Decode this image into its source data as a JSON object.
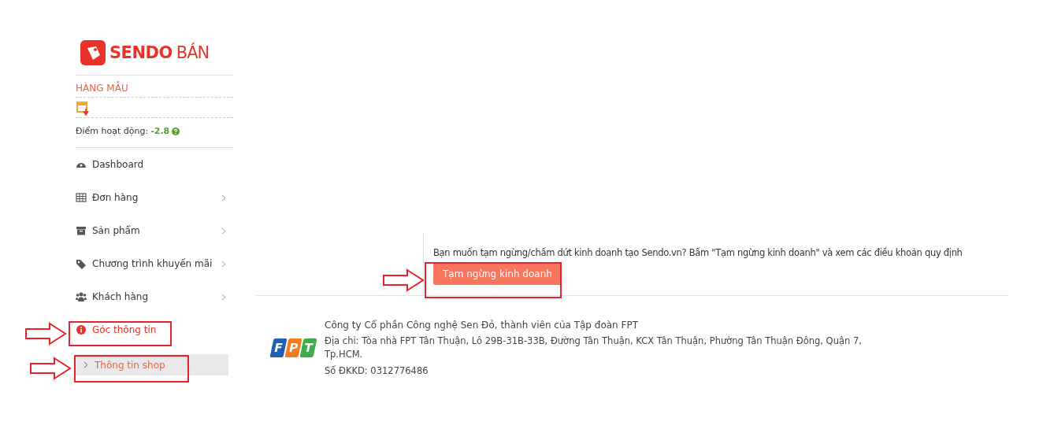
{
  "logo": {
    "brand": "SENDO",
    "suffix": "BÁN"
  },
  "shop": {
    "name": "HÀNG MẪU",
    "score_label": "Điểm hoạt động:",
    "score": "-2.8"
  },
  "sidebar": {
    "items": [
      {
        "label": "Dashboard",
        "kind": "dashboard",
        "has_submenu": false,
        "selected": false
      },
      {
        "label": "Đơn hàng",
        "kind": "table",
        "has_submenu": true,
        "selected": false
      },
      {
        "label": "Sản phẩm",
        "kind": "box",
        "has_submenu": true,
        "selected": false
      },
      {
        "label": "Chương trình khuyến mãi",
        "kind": "tag",
        "has_submenu": true,
        "selected": false
      },
      {
        "label": "Khách hàng",
        "kind": "users",
        "has_submenu": true,
        "selected": false
      },
      {
        "label": "Góc thông tin",
        "kind": "info",
        "has_submenu": false,
        "selected": true,
        "children": [
          {
            "label": "Thông tin shop",
            "selected": true
          }
        ]
      }
    ]
  },
  "suspend": {
    "text": "Bạn muốn tạm ngừng/chấm dứt kinh doanh tạo Sendo.vn? Bấm \"Tạm ngừng kinh doanh\" và xem các điều khoản quy định",
    "button": "Tạm ngừng kinh doanh"
  },
  "footer": {
    "logo_letters": [
      "F",
      "P",
      "T"
    ],
    "company": "Công ty Cổ phần Công nghệ Sen Đỏ, thành viên của Tập đoàn FPT",
    "address": "Địa chỉ: Tòa nhà FPT Tân Thuận, Lô 29B-31B-33B, Đường Tân Thuận, KCX Tân Thuận, Phường Tân Thuận Đông, Quận 7, Tp.HCM.",
    "registration": "Số ĐKKD: 0312776486"
  }
}
